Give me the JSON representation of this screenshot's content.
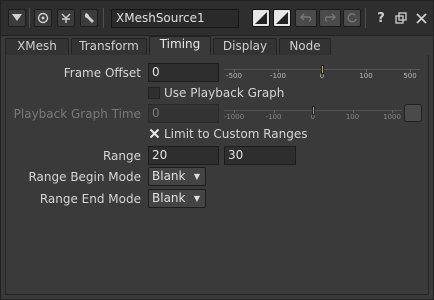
{
  "toolbar": {
    "node_name": "XMeshSource1",
    "help_label": "?"
  },
  "tabs": [
    {
      "label": "XMesh"
    },
    {
      "label": "Transform"
    },
    {
      "label": "Timing"
    },
    {
      "label": "Display"
    },
    {
      "label": "Node"
    }
  ],
  "active_tab": "Timing",
  "fields": {
    "frame_offset": {
      "label": "Frame Offset",
      "value": "0",
      "slider_ticks": [
        "-500",
        "-100",
        "0",
        "100",
        "500"
      ]
    },
    "use_playback_graph": {
      "label": "Use Playback Graph",
      "checked": false
    },
    "playback_graph_time": {
      "label": "Playback Graph Time",
      "value": "0",
      "slider_ticks": [
        "-1000",
        "-100",
        "0",
        "100",
        "1000"
      ]
    },
    "limit_to_custom_ranges": {
      "label": "Limit to Custom Ranges",
      "checked": true
    },
    "range": {
      "label": "Range",
      "start": "20",
      "end": "30"
    },
    "range_begin_mode": {
      "label": "Range Begin Mode",
      "value": "Blank"
    },
    "range_end_mode": {
      "label": "Range End Mode",
      "value": "Blank"
    }
  },
  "colors": {
    "background": "#3a3a3a",
    "toolbar": "#2e2e2e",
    "slider_handle": "#c9a84a"
  }
}
